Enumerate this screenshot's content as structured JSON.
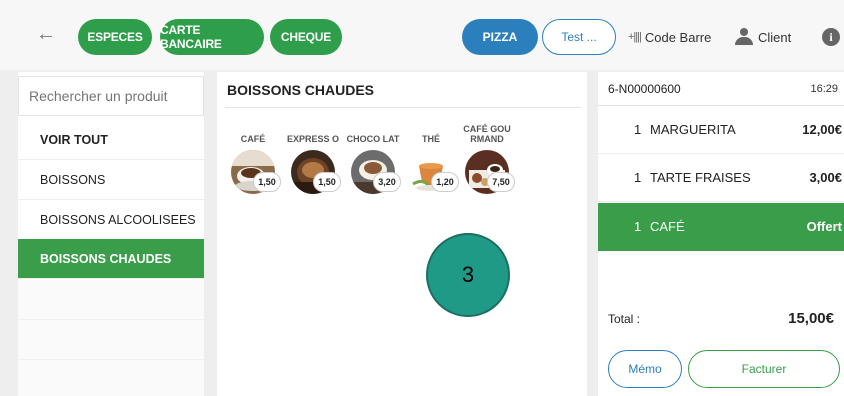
{
  "topbar": {
    "back_icon": "back-arrow-icon",
    "payment_buttons": [
      "ESPECES",
      "CARTE BANCAIRE",
      "CHEQUE"
    ],
    "pizza_label": "PIZZA",
    "test_label": "Test ...",
    "barcode_label": "Code Barre",
    "client_label": "Client",
    "accent_green": "#2e9e4a",
    "accent_blue": "#2c7fbd"
  },
  "sidebar": {
    "search_placeholder": "Rechercher un produit",
    "items": [
      {
        "label": "VOIR TOUT"
      },
      {
        "label": "BOISSONS"
      },
      {
        "label": "BOISSONS ALCOOLISEES"
      },
      {
        "label": "BOISSONS CHAUDES"
      }
    ]
  },
  "middle": {
    "title": "BOISSONS CHAUDES",
    "products": [
      {
        "name": "CAFÉ",
        "price": "1,50"
      },
      {
        "name": "EXPRESS O",
        "price": "1,50"
      },
      {
        "name": "CHOCO LAT",
        "price": "3,20"
      },
      {
        "name": "THÉ",
        "price": "1,20"
      },
      {
        "name": "CAFÉ GOU RMAND",
        "price": "7,50"
      }
    ]
  },
  "step_marker": "3",
  "ticket": {
    "id": "6-N00000600",
    "time": "16:29",
    "lines": [
      {
        "qty": "1",
        "name": "MARGUERITA",
        "amount": "12,00€"
      },
      {
        "qty": "1",
        "name": "TARTE FRAISES",
        "amount": "3,00€"
      },
      {
        "qty": "1",
        "name": "CAFÉ",
        "amount": "Offert"
      }
    ],
    "total_label": "Total :",
    "total_value": "15,00€",
    "memo_label": "Mémo",
    "facturer_label": "Facturer"
  }
}
